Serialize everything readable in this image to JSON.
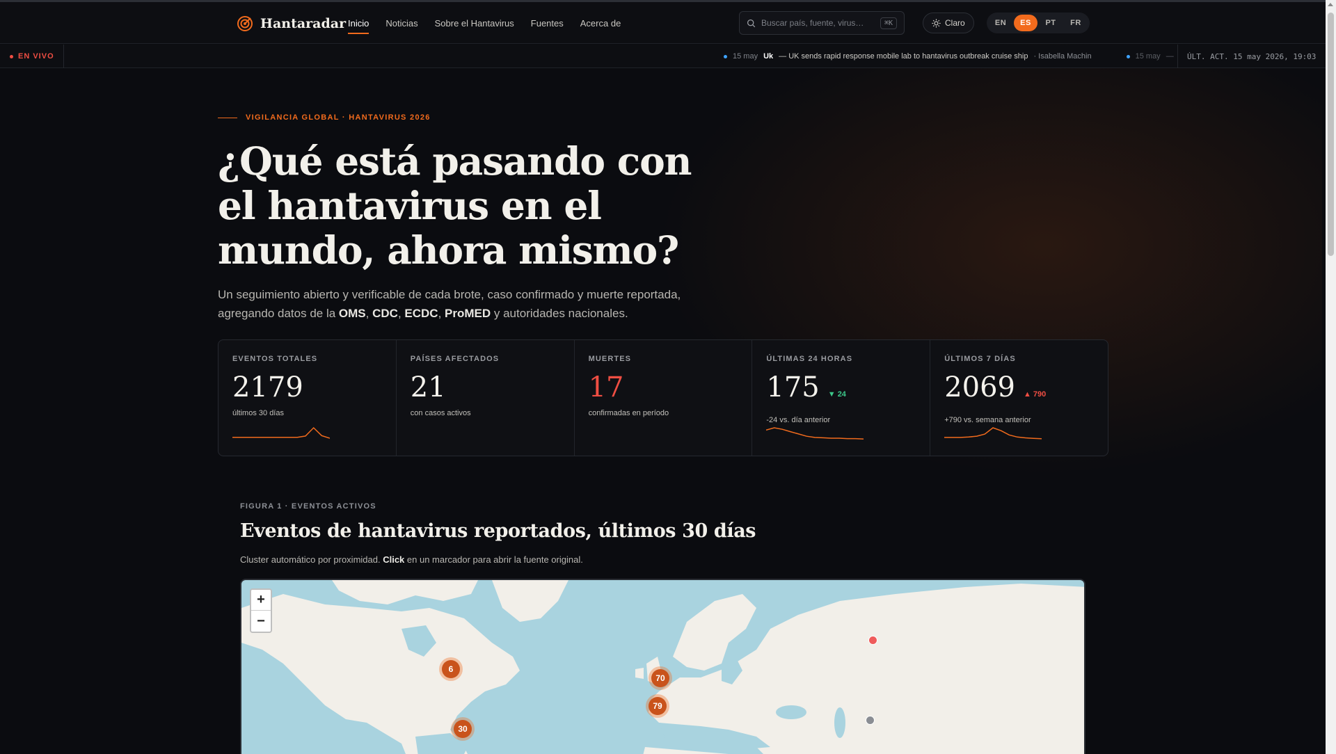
{
  "header": {
    "brand": "Hantaradar",
    "nav": [
      {
        "label": "Inicio",
        "active": true
      },
      {
        "label": "Noticias"
      },
      {
        "label": "Sobre el Hantavirus"
      },
      {
        "label": "Fuentes"
      },
      {
        "label": "Acerca de"
      }
    ],
    "search_placeholder": "Buscar país, fuente, virus…",
    "search_shortcut": "⌘K",
    "theme_label": "Claro",
    "languages": [
      "EN",
      "ES",
      "PT",
      "FR"
    ],
    "active_language": "ES"
  },
  "ticker": {
    "live_label": "EN VIVO",
    "item": {
      "date": "15 may",
      "country": "Uk",
      "text": "— UK sends rapid response mobile lab to hantavirus outbreak cruise ship",
      "author": "· Isabella Machin"
    },
    "next_date": "15 may",
    "next_tail": "—",
    "last_updated": "ÚLT. ACT. 15 may 2026, 19:03"
  },
  "hero": {
    "eyebrow": "VIGILANCIA GLOBAL · HANTAVIRUS 2026",
    "title": "¿Qué está pasando con el hantavirus en el mundo, ahora mismo?",
    "lead_pre": "Un seguimiento abierto y verificable de cada brote, caso confirmado y muerte reportada, agregando datos de la ",
    "sources": [
      "OMS",
      "CDC",
      "ECDC",
      "ProMED"
    ],
    "lead_post": " y autoridades nacionales."
  },
  "stats": [
    {
      "label": "EVENTOS TOTALES",
      "value": "2179",
      "sub": "últimos 30 días",
      "delta": "",
      "spark": [
        1,
        1,
        1,
        1,
        1,
        1,
        1,
        1,
        1,
        1.3,
        3.2,
        1.4,
        0.8
      ]
    },
    {
      "label": "PAÍSES AFECTADOS",
      "value": "21",
      "sub": "con casos activos",
      "delta": "",
      "spark": []
    },
    {
      "label": "MUERTES",
      "value": "17",
      "sub": "confirmadas en período",
      "delta": "",
      "spark": []
    },
    {
      "label": "ÚLTIMAS 24 HORAS",
      "value": "175",
      "sub": "-24 vs. día anterior",
      "delta": "▼ 24",
      "delta_color": "green",
      "spark": [
        3,
        3.6,
        3.2,
        2.6,
        2,
        1.4,
        1.1,
        1,
        0.9,
        0.9,
        0.8,
        0.8,
        0.7
      ]
    },
    {
      "label": "ÚLTIMOS 7 DÍAS",
      "value": "2069",
      "sub": "+790 vs. semana anterior",
      "delta": "▲ 790",
      "delta_color": "red",
      "spark": [
        1,
        1,
        1,
        1.1,
        1.3,
        1.8,
        3.3,
        2.6,
        1.6,
        1.1,
        0.9,
        0.8,
        0.7
      ]
    }
  ],
  "figure": {
    "eyebrow": "FIGURA 1 · EVENTOS ACTIVOS",
    "title": "Eventos de hantavirus reportados, últimos 30 días",
    "caption_pre": "Cluster automático por proximidad. ",
    "caption_bold": "Click",
    "caption_post": " en un marcador para abrir la fuente original.",
    "clusters": [
      {
        "count": "6",
        "region": "North America"
      },
      {
        "count": "70",
        "region": "United Kingdom"
      },
      {
        "count": "79",
        "region": "Iberia"
      },
      {
        "count": "30",
        "region": "Mexico"
      }
    ],
    "markers": [
      {
        "region": "Siberia",
        "color": "#ef5b5b"
      },
      {
        "region": "China",
        "color": "#8a8d93"
      }
    ],
    "zoom_in": "+",
    "zoom_out": "−"
  },
  "colors": {
    "accent": "#f26b1d",
    "danger": "#ef4e43",
    "success": "#3cc88a",
    "bg": "#0b0c10"
  }
}
